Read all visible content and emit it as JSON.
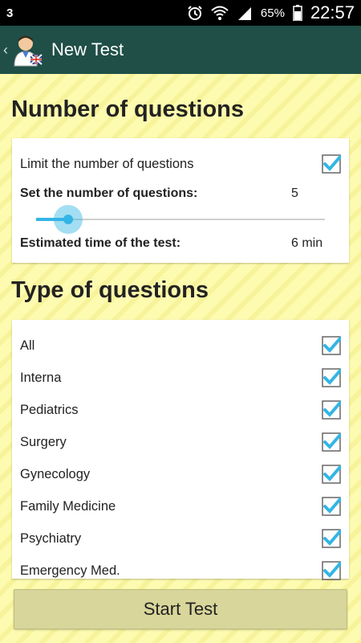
{
  "status": {
    "notification": "3",
    "battery": "65%",
    "time": "22:57"
  },
  "app": {
    "title": "New Test",
    "back_glyph": "‹"
  },
  "number_section": {
    "title": "Number of questions",
    "limit_label": "Limit the number of questions",
    "limit_checked": true,
    "set_label": "Set the number of questions:",
    "set_value": "5",
    "slider_fraction": 0.11,
    "time_label": "Estimated time of the test:",
    "time_value": "6 min"
  },
  "type_section": {
    "title": "Type of questions",
    "items": [
      {
        "label": "All",
        "checked": true
      },
      {
        "label": "Interna",
        "checked": true
      },
      {
        "label": "Pediatrics",
        "checked": true
      },
      {
        "label": "Surgery",
        "checked": true
      },
      {
        "label": "Gynecology",
        "checked": true
      },
      {
        "label": "Family Medicine",
        "checked": true
      },
      {
        "label": "Psychiatry",
        "checked": true
      },
      {
        "label": "Emergency Med.",
        "checked": true
      }
    ]
  },
  "start_button": "Start Test",
  "colors": {
    "accent": "#33b5e5",
    "actionbar": "#1f4f47",
    "background": "#fdfbb0"
  }
}
